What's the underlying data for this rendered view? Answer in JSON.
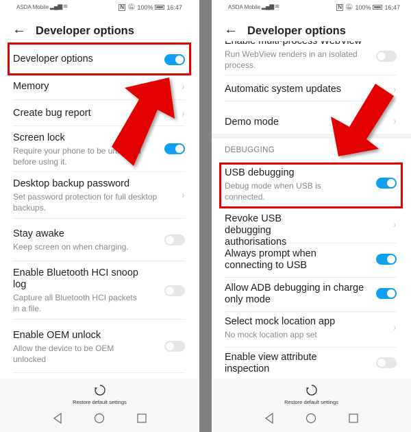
{
  "status_bar": {
    "carrier": "ASDA Mobile",
    "signal_icon": "signal-bars-icon",
    "wifi_icon": "wifi-icon",
    "nfc_label": "N",
    "battery_percent": "100%",
    "time": "16:47"
  },
  "header": {
    "title": "Developer options",
    "back_icon": "arrow-left-icon"
  },
  "left_panel": {
    "rows": [
      {
        "label": "Developer options",
        "control": "toggle",
        "state": "on"
      },
      {
        "label": "Memory",
        "control": "chevron"
      },
      {
        "label": "Create bug report",
        "control": "chevron"
      },
      {
        "label": "Screen lock",
        "sub": "Require your phone to be unlocked before using it.",
        "control": "toggle",
        "state": "on"
      },
      {
        "label": "Desktop backup password",
        "sub": "Set password protection for full desktop backups.",
        "control": "chevron"
      },
      {
        "label": "Stay awake",
        "sub": "Keep screen on when charging.",
        "control": "toggle",
        "state": "off"
      },
      {
        "label": "Enable Bluetooth HCI snoop log",
        "sub": "Capture all Bluetooth HCI packets in a file.",
        "control": "toggle",
        "state": "off"
      },
      {
        "label": "Enable OEM unlock",
        "sub": "Allow the device to be OEM unlocked",
        "control": "toggle",
        "state": "off"
      }
    ]
  },
  "right_panel": {
    "rows_top": [
      {
        "label": "Enable multi-process WebView",
        "sub": "Run WebView renders in an isolated process.",
        "control": "toggle",
        "state": "off"
      },
      {
        "label": "Automatic system updates",
        "control": "chevron"
      },
      {
        "label": "Demo mode",
        "control": "chevron"
      }
    ],
    "section_header": "DEBUGGING",
    "rows": [
      {
        "label": "USB debugging",
        "sub": "Debug mode when USB is connected.",
        "control": "toggle",
        "state": "on"
      },
      {
        "label": "Revoke USB debugging authorisations",
        "control": "chevron"
      },
      {
        "label": "Always prompt when connecting to USB",
        "control": "toggle",
        "state": "on"
      },
      {
        "label": "Allow ADB debugging in charge only mode",
        "control": "toggle",
        "state": "on"
      },
      {
        "label": "Select mock location app",
        "sub": "No mock location app set",
        "control": "chevron"
      },
      {
        "label": "Enable view attribute inspection",
        "control": "toggle",
        "state": "off"
      }
    ]
  },
  "footer": {
    "restore_label": "Restore default settings",
    "restore_icon": "refresh-icon"
  },
  "nav_bar": {
    "back": "nav-back-icon",
    "home": "nav-home-icon",
    "recents": "nav-recents-icon"
  },
  "annotations": {
    "highlight_color": "#e30000",
    "toggle_on_color": "#0fa0f0"
  }
}
